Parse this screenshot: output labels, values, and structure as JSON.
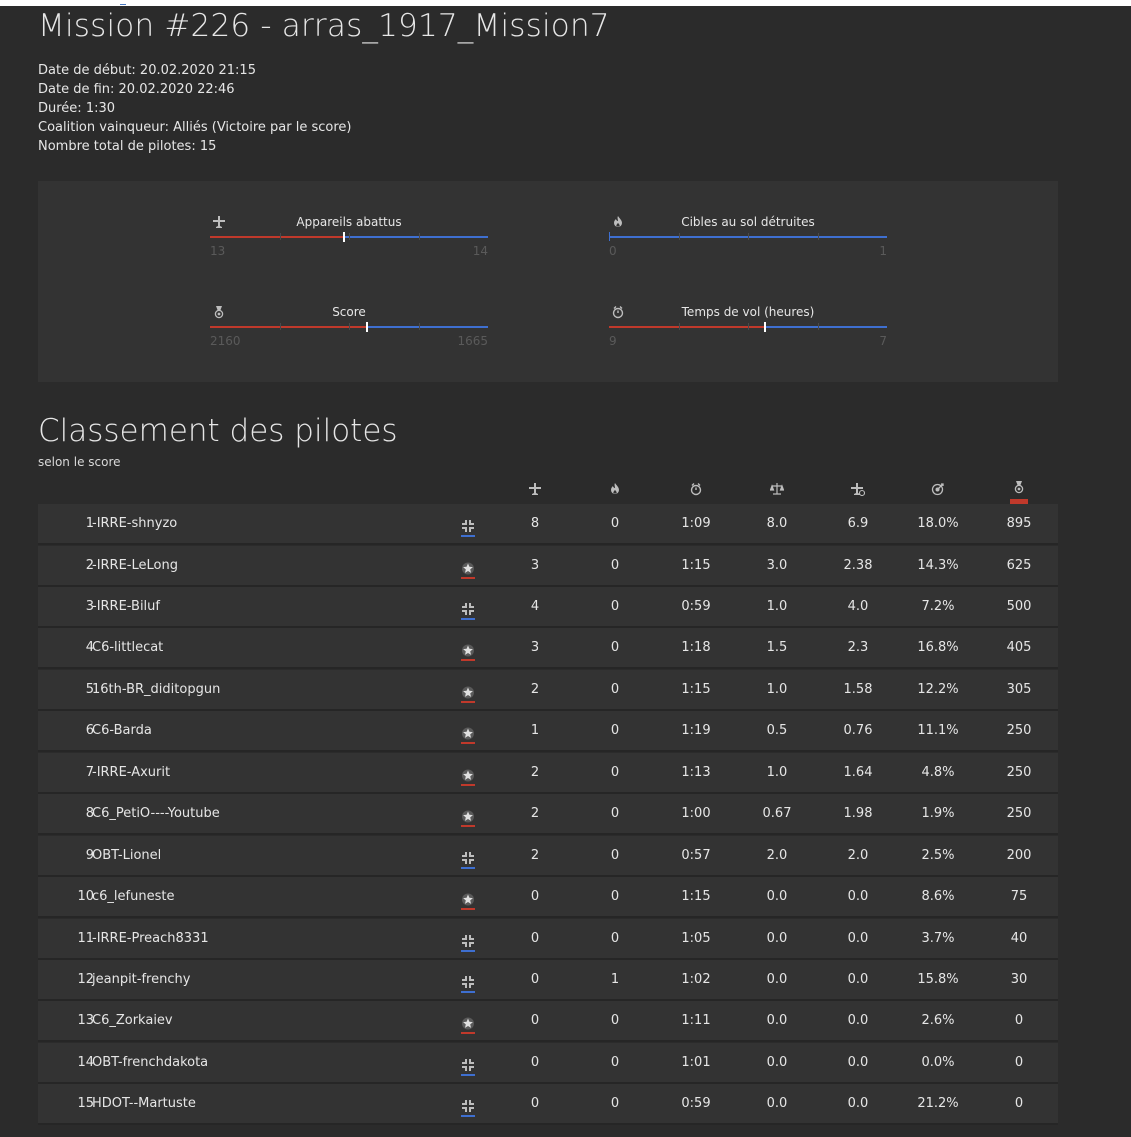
{
  "mission": {
    "title": "Mission #226 - arras_1917_Mission7",
    "start_line": "Date de début: 20.02.2020 21:15",
    "end_line": "Date de fin: 20.02.2020 22:46",
    "duration_line": "Durée: 1:30",
    "winner_line": "Coalition vainqueur: Alliés (Victoire par le score)",
    "pilots_line": "Nombre total de pilotes: 15"
  },
  "stats": [
    {
      "icon": "plane-icon",
      "label": "Appareils abattus",
      "left": "13",
      "right": "14",
      "red_fraction": 0.4815
    },
    {
      "icon": "fire-icon",
      "label": "Cibles au sol détruites",
      "left": "0",
      "right": "1",
      "red_fraction": 0.0
    },
    {
      "icon": "medal-icon",
      "label": "Score",
      "left": "2160",
      "right": "1665",
      "red_fraction": 0.5647
    },
    {
      "icon": "stopwatch-icon",
      "label": "Temps de vol (heures)",
      "left": "9",
      "right": "7",
      "red_fraction": 0.5625
    }
  ],
  "colors": {
    "red_team": "#c0392b",
    "blue_team": "#3e6fd0"
  },
  "ranking": {
    "title": "Classement des pilotes",
    "subtitle": "selon le score",
    "columns": [
      "plane-icon",
      "fire-icon",
      "stopwatch-icon",
      "balance-icon",
      "plane-ratio-icon",
      "target-icon",
      "medal-icon"
    ],
    "rows": [
      {
        "rank": "1",
        "name": "-IRRE-shnyzo",
        "coalition": "central",
        "kills": "8",
        "ground": "0",
        "time": "1:09",
        "kd": "8.0",
        "kh": "6.9",
        "acc": "18.0%",
        "score": "895"
      },
      {
        "rank": "2",
        "name": "-IRRE-LeLong",
        "coalition": "allied",
        "kills": "3",
        "ground": "0",
        "time": "1:15",
        "kd": "3.0",
        "kh": "2.38",
        "acc": "14.3%",
        "score": "625"
      },
      {
        "rank": "3",
        "name": "-IRRE-Biluf",
        "coalition": "central",
        "kills": "4",
        "ground": "0",
        "time": "0:59",
        "kd": "1.0",
        "kh": "4.0",
        "acc": "7.2%",
        "score": "500"
      },
      {
        "rank": "4",
        "name": "C6-littlecat",
        "coalition": "allied",
        "kills": "3",
        "ground": "0",
        "time": "1:18",
        "kd": "1.5",
        "kh": "2.3",
        "acc": "16.8%",
        "score": "405"
      },
      {
        "rank": "5",
        "name": "16th-BR_diditopgun",
        "coalition": "allied",
        "kills": "2",
        "ground": "0",
        "time": "1:15",
        "kd": "1.0",
        "kh": "1.58",
        "acc": "12.2%",
        "score": "305"
      },
      {
        "rank": "6",
        "name": "C6-Barda",
        "coalition": "allied",
        "kills": "1",
        "ground": "0",
        "time": "1:19",
        "kd": "0.5",
        "kh": "0.76",
        "acc": "11.1%",
        "score": "250"
      },
      {
        "rank": "7",
        "name": "-IRRE-Axurit",
        "coalition": "allied",
        "kills": "2",
        "ground": "0",
        "time": "1:13",
        "kd": "1.0",
        "kh": "1.64",
        "acc": "4.8%",
        "score": "250"
      },
      {
        "rank": "8",
        "name": "C6_PetiO----Youtube",
        "coalition": "allied",
        "kills": "2",
        "ground": "0",
        "time": "1:00",
        "kd": "0.67",
        "kh": "1.98",
        "acc": "1.9%",
        "score": "250"
      },
      {
        "rank": "9",
        "name": "OBT-Lionel",
        "coalition": "central",
        "kills": "2",
        "ground": "0",
        "time": "0:57",
        "kd": "2.0",
        "kh": "2.0",
        "acc": "2.5%",
        "score": "200"
      },
      {
        "rank": "10",
        "name": "c6_lefuneste",
        "coalition": "allied",
        "kills": "0",
        "ground": "0",
        "time": "1:15",
        "kd": "0.0",
        "kh": "0.0",
        "acc": "8.6%",
        "score": "75"
      },
      {
        "rank": "11",
        "name": "-IRRE-Preach8331",
        "coalition": "central",
        "kills": "0",
        "ground": "0",
        "time": "1:05",
        "kd": "0.0",
        "kh": "0.0",
        "acc": "3.7%",
        "score": "40"
      },
      {
        "rank": "12",
        "name": "jeanpit-frenchy",
        "coalition": "central",
        "kills": "0",
        "ground": "1",
        "time": "1:02",
        "kd": "0.0",
        "kh": "0.0",
        "acc": "15.8%",
        "score": "30"
      },
      {
        "rank": "13",
        "name": "C6_Zorkaiev",
        "coalition": "allied",
        "kills": "0",
        "ground": "0",
        "time": "1:11",
        "kd": "0.0",
        "kh": "0.0",
        "acc": "2.6%",
        "score": "0"
      },
      {
        "rank": "14",
        "name": "OBT-frenchdakota",
        "coalition": "central",
        "kills": "0",
        "ground": "0",
        "time": "1:01",
        "kd": "0.0",
        "kh": "0.0",
        "acc": "0.0%",
        "score": "0"
      },
      {
        "rank": "15",
        "name": "HDOT--Martuste",
        "coalition": "central",
        "kills": "0",
        "ground": "0",
        "time": "0:59",
        "kd": "0.0",
        "kh": "0.0",
        "acc": "21.2%",
        "score": "0"
      }
    ]
  }
}
